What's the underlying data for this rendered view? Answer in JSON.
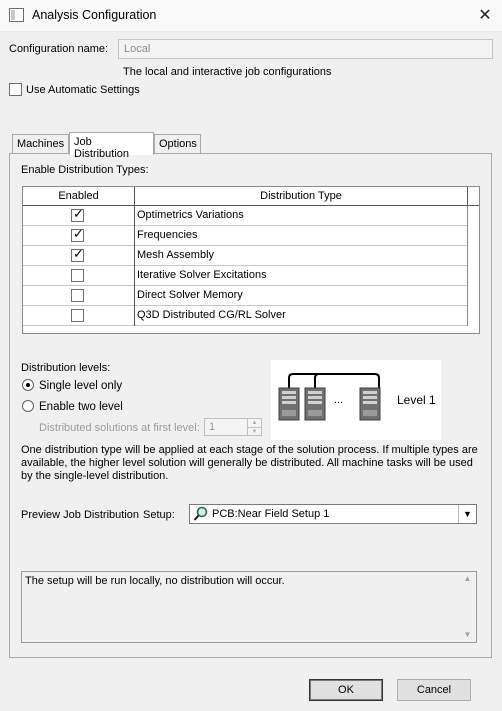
{
  "window": {
    "title": "Analysis Configuration",
    "icons": {
      "app": "dialog-icon",
      "close": "close-icon"
    }
  },
  "config": {
    "name_label": "Configuration name:",
    "name_value": "Local",
    "description": "The local and interactive job configurations",
    "use_auto_label": "Use Automatic Settings",
    "use_auto_checked": false
  },
  "tabs": [
    {
      "label": "Machines",
      "active": false
    },
    {
      "label": "Job Distribution",
      "active": true
    },
    {
      "label": "Options",
      "active": false
    }
  ],
  "distribution": {
    "enable_types_label": "Enable Distribution Types:",
    "columns": [
      "Enabled",
      "Distribution Type"
    ],
    "rows": [
      {
        "enabled": true,
        "type": "Optimetrics Variations"
      },
      {
        "enabled": true,
        "type": "Frequencies"
      },
      {
        "enabled": true,
        "type": "Mesh Assembly"
      },
      {
        "enabled": false,
        "type": "Iterative Solver Excitations"
      },
      {
        "enabled": false,
        "type": "Direct Solver Memory"
      },
      {
        "enabled": false,
        "type": "Q3D Distributed CG/RL Solver"
      }
    ],
    "levels_label": "Distribution levels:",
    "single_level_label": "Single level only",
    "two_level_label": "Enable two level",
    "selected_level": "single",
    "first_level_label": "Distributed solutions at first level:",
    "first_level_value": "1",
    "diagram_level_label": "Level 1",
    "diagram_ellipsis": "...",
    "info_text": "One distribution type will be applied at each stage of the solution process. If multiple types are available, the higher level solution will generally be distributed. All machine tasks will be used by the single-level distribution."
  },
  "preview": {
    "label": "Preview Job Distribution",
    "setup_label": "Setup:",
    "setup_value": "PCB:Near Field Setup 1",
    "message": "The setup will be run locally, no distribution will occur."
  },
  "buttons": {
    "ok": "OK",
    "cancel": "Cancel"
  }
}
